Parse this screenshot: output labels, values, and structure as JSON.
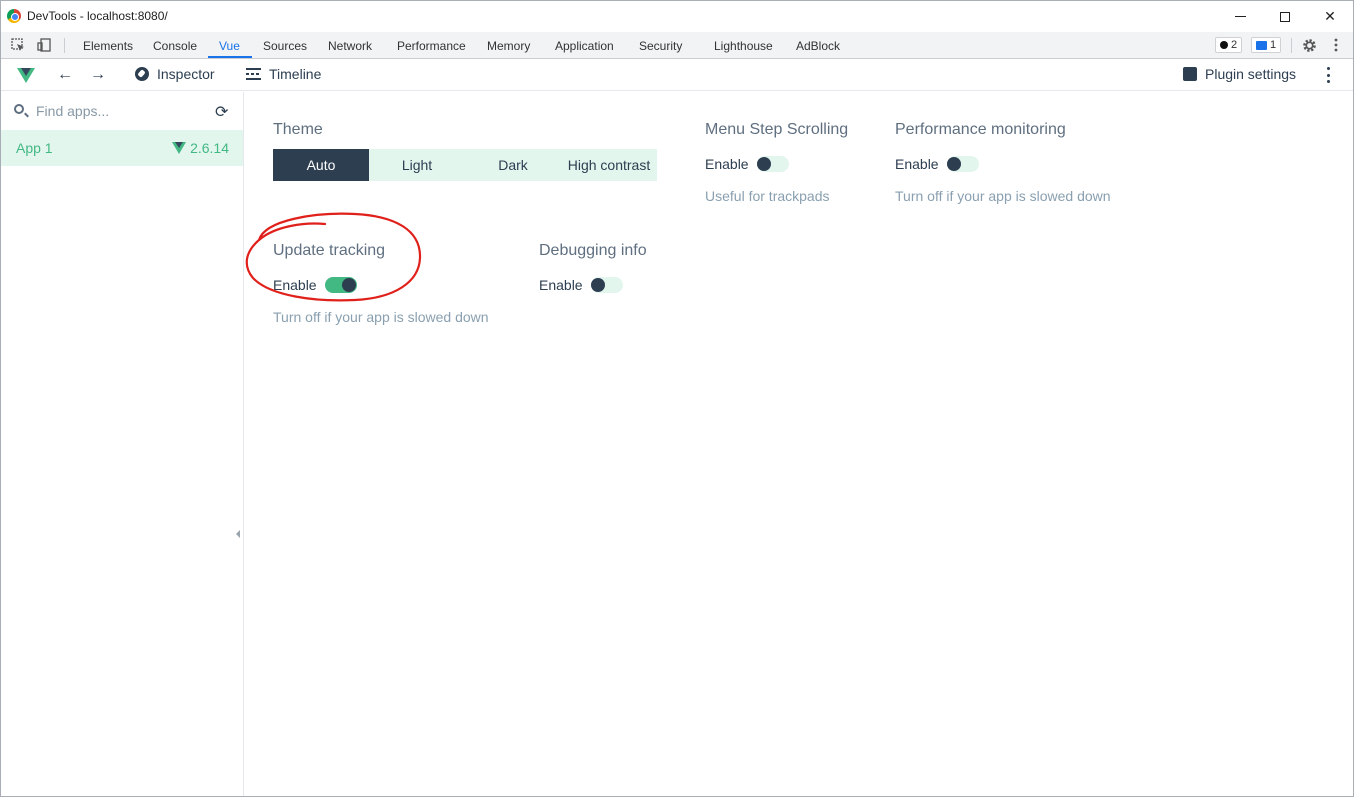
{
  "window": {
    "title": "DevTools - localhost:8080/"
  },
  "devtools": {
    "tabs": [
      {
        "label": "Elements"
      },
      {
        "label": "Console"
      },
      {
        "label": "Vue",
        "active": true
      },
      {
        "label": "Sources"
      },
      {
        "label": "Network"
      },
      {
        "label": "Performance"
      },
      {
        "label": "Memory"
      },
      {
        "label": "Application"
      },
      {
        "label": "Security"
      },
      {
        "label": "Lighthouse"
      },
      {
        "label": "AdBlock"
      }
    ],
    "errors_count": "2",
    "messages_count": "1",
    "active_color": "#1a73e8"
  },
  "vue_toolbar": {
    "inspector_label": "Inspector",
    "timeline_label": "Timeline",
    "plugin_settings_label": "Plugin settings"
  },
  "sidebar": {
    "search_placeholder": "Find apps...",
    "apps": [
      {
        "name": "App 1",
        "version": "2.6.14",
        "selected": true
      }
    ]
  },
  "settings": {
    "theme": {
      "title": "Theme",
      "options": [
        "Auto",
        "Light",
        "Dark",
        "High contrast"
      ],
      "selected": "Auto"
    },
    "menu_step_scrolling": {
      "title": "Menu Step Scrolling",
      "toggle_label": "Enable",
      "enabled": false,
      "description": "Useful for trackpads"
    },
    "performance_monitoring": {
      "title": "Performance monitoring",
      "toggle_label": "Enable",
      "enabled": false,
      "description": "Turn off if your app is slowed down"
    },
    "update_tracking": {
      "title": "Update tracking",
      "toggle_label": "Enable",
      "enabled": true,
      "description": "Turn off if your app is slowed down"
    },
    "debugging_info": {
      "title": "Debugging info",
      "toggle_label": "Enable",
      "enabled": false
    }
  },
  "colors": {
    "vue_green": "#42b883",
    "vue_dark": "#2c3e50",
    "selected_bg": "#e3f6ee",
    "annotation_red": "#e0201b"
  }
}
